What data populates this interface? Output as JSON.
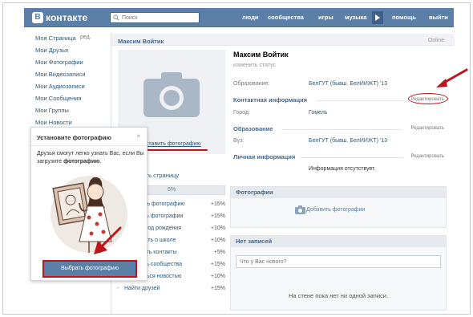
{
  "header": {
    "logo_letter": "В",
    "logo_text": "контакте",
    "search_placeholder": "Поиск",
    "nav": [
      "люди",
      "сообщества",
      "игры",
      "музыка",
      "помощь",
      "выйти"
    ]
  },
  "sidebar": {
    "items": [
      "Моя Страница",
      "Мои Друзья",
      "Мои Фотографии",
      "Мои Видеозаписи",
      "Мои Аудиозаписи",
      "Мои Сообщения",
      "Мои Группы",
      "Мои Новости"
    ],
    "edit_label": "ред."
  },
  "profile": {
    "header_name": "Максим Войтик",
    "online": "Online",
    "name": "Максим Войтик",
    "status": "изменить статус",
    "education_label": "Образование:",
    "education_value": "БелГУТ (бывш. БелИИЖТ) '13",
    "contact_section": "Контактная информация",
    "edit_link": "Редактировать",
    "city_label": "Город:",
    "city_value": "Гомель",
    "education_section": "Образование",
    "university_label": "Вуз:",
    "university_value": "БелГУТ (бывш. БелИИЖТ) '13",
    "personal_section": "Личная информация",
    "personal_empty": "Информация отсутствует."
  },
  "avatar": {
    "set_photo": "Поставить фотографию"
  },
  "edit_page": "…ктировать страницу",
  "progress": {
    "value": 5,
    "text": "5%"
  },
  "tasks": [
    {
      "label": "Загрузить фотографию",
      "pct": "+15%"
    },
    {
      "label": "Добавить фотографии",
      "pct": "+15%"
    },
    {
      "label": "Указать год рождения",
      "pct": "+10%"
    },
    {
      "label": "Рассказать о школе",
      "pct": "+10%"
    },
    {
      "label": "Заполнить контакты",
      "pct": "+5%"
    },
    {
      "label": "Добавить сообщества",
      "pct": "+15%"
    },
    {
      "label": "Поделиться новостью",
      "pct": "+10%"
    },
    {
      "label": "Найти друзей",
      "pct": "+15%"
    }
  ],
  "photos": {
    "title": "Фотографии",
    "add_photos": "Добавить фотографии"
  },
  "wall": {
    "title": "Нет записей",
    "placeholder": "Что у Вас нового?",
    "empty": "На стене пока нет ни одной записи."
  },
  "popup": {
    "title": "Установите фотографию",
    "close": "×",
    "text_before": "Друзья смогут легко узнать Вас, если Вы загрузите ",
    "text_bold": "фотографию",
    "text_after": ".",
    "button": "Выбрать фотографию"
  },
  "colors": {
    "brand": "#5b7fa6",
    "link": "#2b587a",
    "highlight": "#c0141b"
  }
}
